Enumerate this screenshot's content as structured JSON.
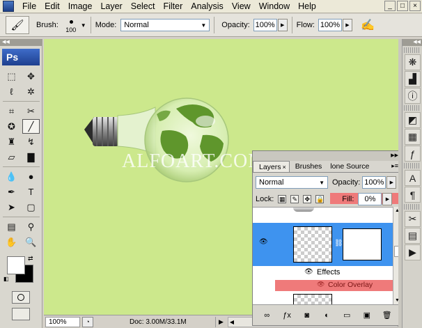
{
  "menubar": {
    "items": [
      "File",
      "Edit",
      "Image",
      "Layer",
      "Select",
      "Filter",
      "Analysis",
      "View",
      "Window",
      "Help"
    ],
    "window_buttons": [
      "_",
      "□",
      "×"
    ]
  },
  "options_bar": {
    "brush_label": "Brush:",
    "brush_size": "100",
    "mode_label": "Mode:",
    "mode_value": "Normal",
    "opacity_label": "Opacity:",
    "opacity_value": "100%",
    "flow_label": "Flow:",
    "flow_value": "100%"
  },
  "toolbox": {
    "logo": "Ps",
    "tools": [
      {
        "name": "marquee-tool",
        "glyph": "⬚"
      },
      {
        "name": "move-tool",
        "glyph": "✥"
      },
      {
        "name": "lasso-tool",
        "glyph": "ℓ"
      },
      {
        "name": "magic-wand-tool",
        "glyph": "✲"
      },
      {
        "name": "crop-tool",
        "glyph": "⌗"
      },
      {
        "name": "slice-tool",
        "glyph": "✂"
      },
      {
        "name": "healing-brush-tool",
        "glyph": "✪"
      },
      {
        "name": "brush-tool",
        "glyph": "╱",
        "active": true
      },
      {
        "name": "clone-stamp-tool",
        "glyph": "♜"
      },
      {
        "name": "history-brush-tool",
        "glyph": "↯"
      },
      {
        "name": "eraser-tool",
        "glyph": "▱"
      },
      {
        "name": "gradient-tool",
        "glyph": "▇"
      },
      {
        "name": "blur-tool",
        "glyph": "💧"
      },
      {
        "name": "dodge-tool",
        "glyph": "●"
      },
      {
        "name": "pen-tool",
        "glyph": "✒"
      },
      {
        "name": "type-tool",
        "glyph": "T"
      },
      {
        "name": "path-selection-tool",
        "glyph": "➤"
      },
      {
        "name": "shape-tool",
        "glyph": "▢"
      },
      {
        "name": "notes-tool",
        "glyph": "▤"
      },
      {
        "name": "eyedropper-tool",
        "glyph": "⚲"
      },
      {
        "name": "hand-tool",
        "glyph": "✋"
      },
      {
        "name": "zoom-tool",
        "glyph": "🔍"
      }
    ],
    "foreground_color": "#ffffff",
    "background_color": "#000000"
  },
  "canvas": {
    "background_color": "#cce88c",
    "watermark": "ALFOART.COM"
  },
  "statusbar": {
    "zoom": "100%",
    "doc_info": "Doc: 3.00M/33.1M"
  },
  "layers_panel": {
    "tabs": [
      {
        "label": "Layers",
        "active": true,
        "closable": true
      },
      {
        "label": "Brushes",
        "active": false
      },
      {
        "label": "lone Source",
        "active": false
      }
    ],
    "blend_mode": "Normal",
    "opacity_label": "Opacity:",
    "opacity_value": "100%",
    "lock_label": "Lock:",
    "fill_label": "Fill:",
    "fill_value": "0%",
    "effects_label": "Effects",
    "color_overlay_label": "Color Overlay",
    "highlight_color": "#ef7a7a",
    "selected_row_color": "#3e93ef"
  },
  "right_dock": {
    "icons": [
      "navigator-icon",
      "histogram-icon",
      "info-icon",
      "color-icon",
      "swatches-icon",
      "styles-icon",
      "character-icon",
      "paragraph-icon",
      "tools-preset-icon",
      "actions-icon"
    ]
  }
}
